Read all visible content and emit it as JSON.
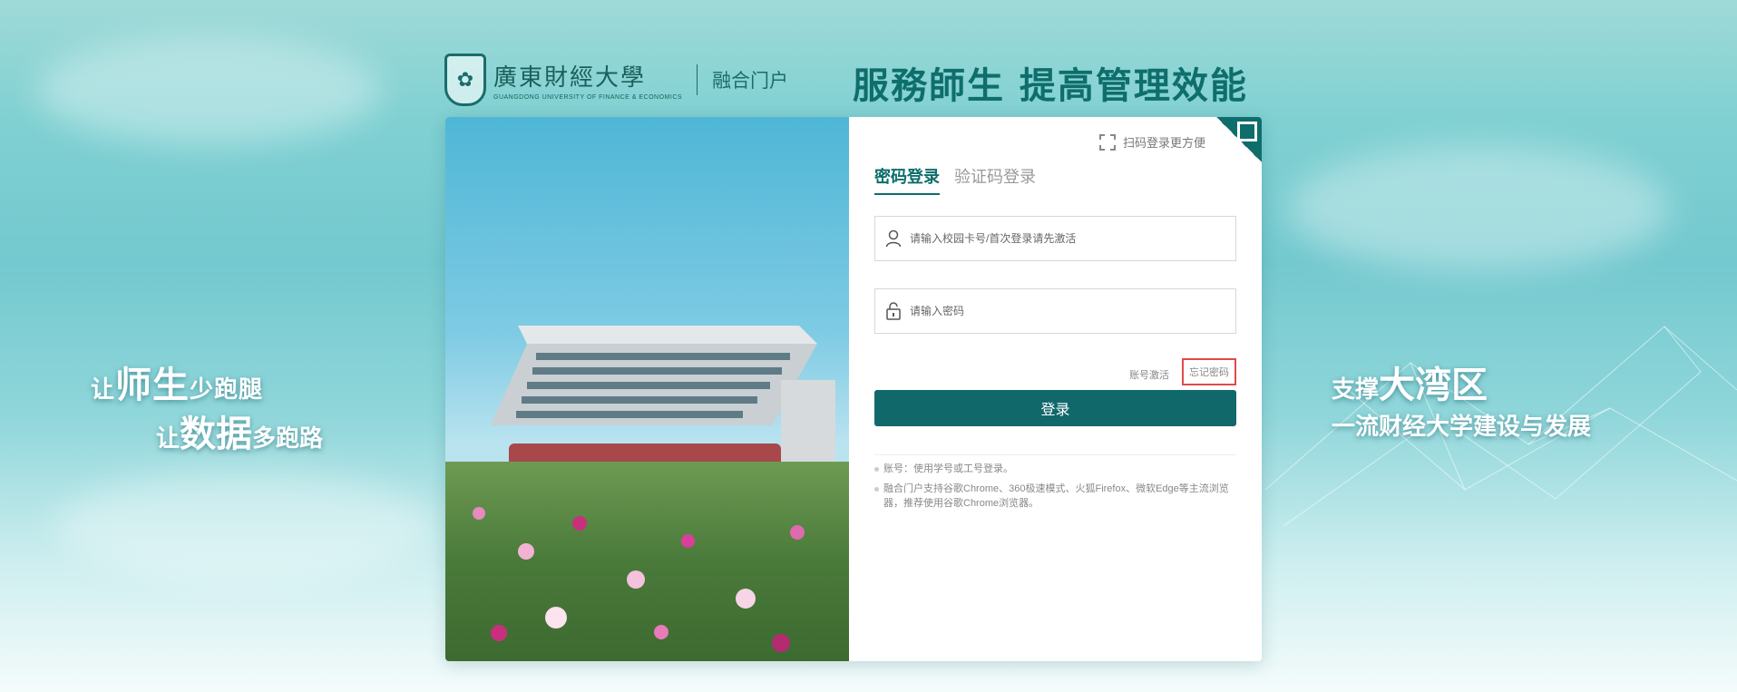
{
  "header": {
    "university_cn": "廣東財經大學",
    "university_en": "GUANGDONG UNIVERSITY OF FINANCE & ECONOMICS",
    "portal": "融合门户",
    "slogan": "服務師生  提高管理效能"
  },
  "slogan_left": {
    "line1_prefix": "让",
    "line1_big": "师生",
    "line1_suffix": "少跑腿",
    "line2_prefix": "让",
    "line2_big": "数据",
    "line2_suffix": "多跑路"
  },
  "slogan_right": {
    "line1_prefix": "支撑",
    "line1_big": "大湾区",
    "line2": "一流财经大学建设与发展"
  },
  "login": {
    "qr_hint": "扫码登录更方便",
    "tabs": [
      {
        "label": "密码登录",
        "active": true
      },
      {
        "label": "验证码登录",
        "active": false
      }
    ],
    "username_placeholder": "请输入校园卡号/首次登录请先激活",
    "password_placeholder": "请输入密码",
    "activate_link": "账号激活",
    "forgot_link": "忘记密码",
    "submit": "登录",
    "tips": [
      "账号：使用学号或工号登录。",
      "融合门户支持谷歌Chrome、360极速模式、火狐Firefox、微软Edge等主流浏览器，推荐使用谷歌Chrome浏览器。"
    ]
  },
  "colors": {
    "brand": "#11686b",
    "highlight": "#e04a4a"
  }
}
